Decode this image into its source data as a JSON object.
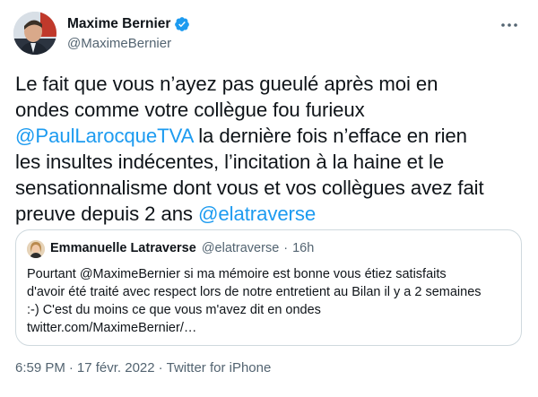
{
  "author": {
    "name": "Maxime Bernier",
    "handle": "@MaximeBernier",
    "verified": true,
    "avatar_icon": "user-avatar-icon",
    "verified_icon": "verified-badge-icon",
    "accent_color": "#1d9bf0"
  },
  "menu": {
    "icon": "more-dots-icon"
  },
  "tweet": {
    "line1": "Le fait que vous n’ayez pas gueulé après moi en",
    "line2": "ondes comme votre collègue fou furieux",
    "mention1": "@PaulLarocqueTVA",
    "line3_rest": " la dernière fois n’efface en rien",
    "line4": "les insultes indécentes, l’incitation à la haine et le",
    "line5": "sensationnalisme dont vous et vos collègues avez fait",
    "line6_start": "preuve depuis 2 ans ",
    "mention2": "@elatraverse"
  },
  "quote": {
    "name": "Emmanuelle Latraverse",
    "handle": "@elatraverse",
    "separator": "·",
    "time": "16h",
    "lines": [
      "Pourtant @MaximeBernier si ma mémoire est bonne vous étiez satisfaits",
      "d'avoir été traité avec respect lors de notre entretient au Bilan il y a 2 semaines",
      ":-) C'est du moins ce que vous m'avez dit en ondes",
      "twitter.com/MaximeBernier/…"
    ]
  },
  "meta": {
    "time": "6:59 PM",
    "date": "17 févr. 2022",
    "separator": "·",
    "source": "Twitter for iPhone"
  }
}
